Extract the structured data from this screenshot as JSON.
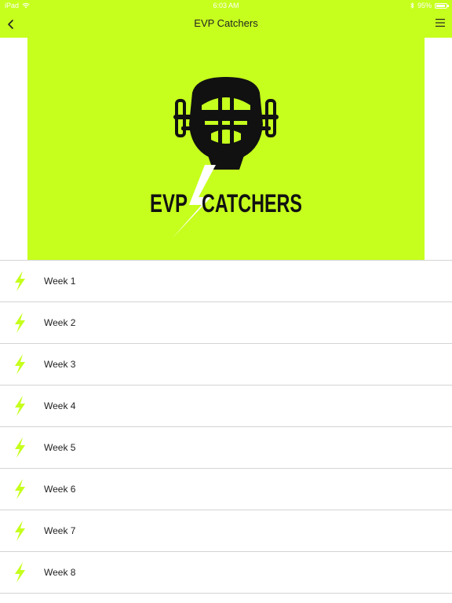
{
  "status_bar": {
    "device": "iPad",
    "time": "6:03 AM",
    "battery": "95%",
    "battery_level": 0.95
  },
  "nav": {
    "title": "EVP Catchers",
    "back_icon": "chevron-left-icon",
    "menu_icon": "hamburger-menu-icon"
  },
  "banner": {
    "logo_text_left": "EVP",
    "logo_text_right": "CATCHERS",
    "logo_icon": "catcher-mask-icon"
  },
  "weeks": [
    {
      "label": "Week 1"
    },
    {
      "label": "Week 2"
    },
    {
      "label": "Week 3"
    },
    {
      "label": "Week 4"
    },
    {
      "label": "Week 5"
    },
    {
      "label": "Week 6"
    },
    {
      "label": "Week 7"
    },
    {
      "label": "Week 8"
    }
  ],
  "colors": {
    "brand": "#c6ff1d",
    "text": "#222222",
    "divider": "#d4d4d4"
  }
}
